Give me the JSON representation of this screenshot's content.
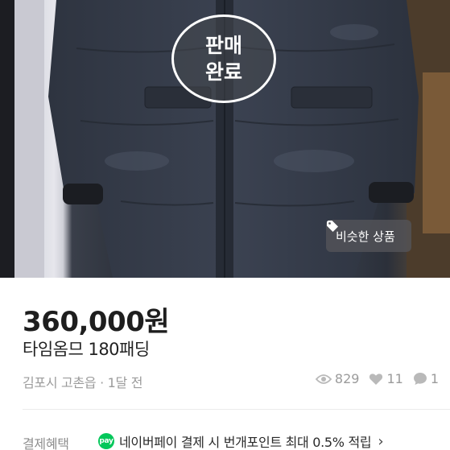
{
  "badge": {
    "line1": "판매",
    "line2": "완료"
  },
  "similar_button": {
    "label": "비슷한 상품",
    "icon": "tag-icon"
  },
  "product": {
    "price": "360,000원",
    "title": "타임옴므 180패딩"
  },
  "meta": {
    "location_time": "김포시 고촌읍 · 1달 전"
  },
  "stats": {
    "views": "829",
    "likes": "11",
    "chats": "1"
  },
  "benefit": {
    "label": "결제혜택",
    "text": "네이버페이 결제 시 번개포인트 최대 0.5% 적립",
    "icon_text": "pay"
  },
  "colors": {
    "npay_green": "#03c75a",
    "text_primary": "#1e1e1e",
    "text_secondary": "#9b9b9b"
  }
}
